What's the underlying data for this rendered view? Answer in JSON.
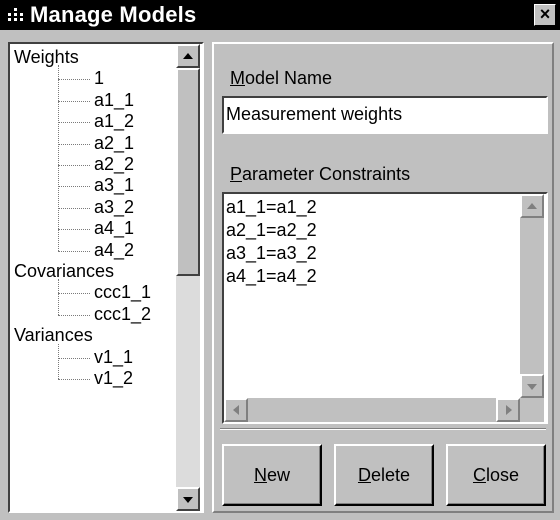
{
  "window": {
    "title": "Manage Models",
    "close_glyph": "×",
    "icon": "dots-icon"
  },
  "tree": {
    "groups": [
      {
        "label": "Weights",
        "items": [
          "1",
          "a1_1",
          "a1_2",
          "a2_1",
          "a2_2",
          "a3_1",
          "a3_2",
          "a4_1",
          "a4_2"
        ]
      },
      {
        "label": "Covariances",
        "items": [
          "ccc1_1",
          "ccc1_2"
        ]
      },
      {
        "label": "Variances",
        "items": [
          "v1_1",
          "v1_2"
        ]
      }
    ]
  },
  "model_name": {
    "label_mnemonic": "M",
    "label_rest": "odel Name",
    "value": "Measurement weights"
  },
  "constraints": {
    "label_mnemonic": "P",
    "label_rest": "arameter Constraints",
    "lines": [
      "a1_1=a1_2",
      "a2_1=a2_2",
      "a3_1=a3_2",
      "a4_1=a4_2"
    ]
  },
  "buttons": {
    "new": {
      "mnemonic": "N",
      "rest": "ew"
    },
    "delete": {
      "mnemonic": "D",
      "rest": "elete"
    },
    "close": {
      "mnemonic": "C",
      "rest": "lose"
    }
  }
}
